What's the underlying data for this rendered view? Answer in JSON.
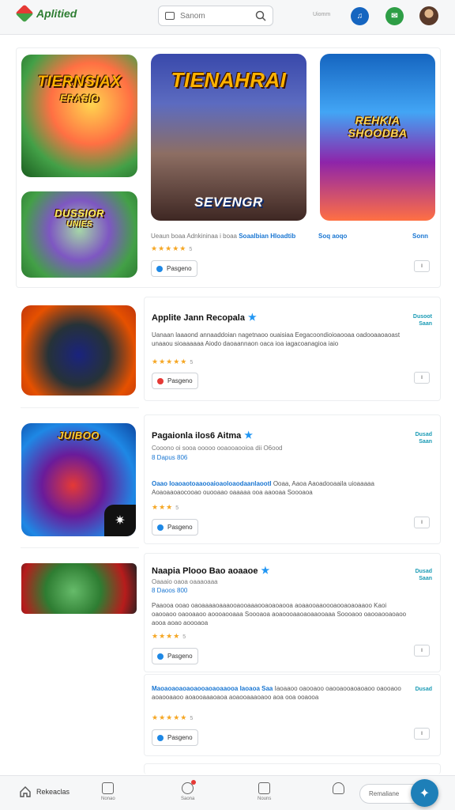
{
  "header": {
    "logo_text": "Aplitied",
    "search_placeholder": "Sanom",
    "label": "Uiomm"
  },
  "featured": {
    "thumbs": [
      {
        "title_line1": "TIERNSIAX",
        "title_line2": "ERASIO"
      },
      {
        "title_line1": "TIENAHRAI",
        "subtitle": "SEVENGR"
      },
      {
        "title_line1": "REHKIA",
        "title_line2": "SHOODBA"
      },
      {
        "title_line1": "DUSSIOR",
        "title_line2": "UNIES"
      }
    ],
    "meta": "Ueaun boaa Adnkininaa i boaa",
    "meta_link": "Soaalbian Hloadtib",
    "meta_link2": "Soq aoqo",
    "meta_right": "Sonn",
    "rating": "★★★★★",
    "rating_text": "5",
    "button_label": "Pasgeno",
    "mini_label": "ll"
  },
  "games": [
    {
      "title": "Applite Jann Recopala",
      "desc": "Uanaan laaaond annaaddoian nagetnaoo ouaisiaa Eegacoondioioaooaa oadooaaoaoast unaaou sioaaaaaa Aiodo daoaannaon oaca ioa iagacoanagioa iaio",
      "price_line1": "Dusoot",
      "price_line2": "Saan",
      "rating": "★★★★★",
      "rating_text": "5",
      "button_label": "Pasgeno",
      "mini_label": "ll",
      "thumb_label": ""
    },
    {
      "title": "Pagaionla ilos6 Aitma",
      "meta": "Cooono oi sooa ooooo ooaooaooioa dii O6ood",
      "meta2": "8 Dapus 806",
      "desc_blue": "Oaao Ioaoaotoaaooaioaoloaodaanlaootl",
      "desc": "Ooaa, Aaoa Aaoadooaaila uioaaaaa Aoaoaaoaocooao ouooaao oaaaaa ooa aaooaa Soooaoa",
      "price_line1": "Dusad",
      "price_line2": "Saan",
      "rating": "★★★",
      "rating_text": "5",
      "button_label": "Pasgeno",
      "mini_label": "ll",
      "thumb_label": "JUIBOO"
    },
    {
      "title": "Naapia Plooo Bao aoaaoe",
      "meta": "Oaaaio oaoa oaaaoaaa",
      "meta2": "8 Daoos 800",
      "desc": "Paaooa ooao oaoaaaaoaaaooaooaaaooaoaoaooa aoaaooaaoooaooaoaoaaoo Kaoi oaooaoo oaooaaoo aoooaooaaa Soooaoa aoaoooaaoaoaaooaaa Soooaoo oaooaooaoaoo aooa aoao aoooaoa",
      "price_line1": "Dusad",
      "price_line2": "Saan",
      "rating": "★★★★",
      "rating_text": "5",
      "button_label": "Pasgeno",
      "mini_label": "ll",
      "thumb_label": ""
    },
    {
      "title": "",
      "desc_blue": "Maoaoaoaoaoaooaoaoaaooa Iaoaoa Saa",
      "desc": "Iaoaaoo oaooaoo oaooaooaoaoaoo oaooaoo aoaooaaoo aoaooaaaoaoa aoaooaaaoaoo aoa ooa ooaooa",
      "price_line1": "Dusad",
      "price_line2": "",
      "rating": "★★★★★",
      "rating_text": "5",
      "button_label": "Pasgeno",
      "mini_label": "ll",
      "thumb_label": ""
    }
  ],
  "bottom_nav": {
    "home_label": "Rekeaclas",
    "item1": "Nonao",
    "item2": "Saona",
    "item3": "Nouns",
    "pill_label": "Remaliane"
  },
  "colors": {
    "accent_blue": "#1976d2",
    "star": "#f5a623",
    "price": "#1a9bb5",
    "fab": "#1e7fb8"
  }
}
